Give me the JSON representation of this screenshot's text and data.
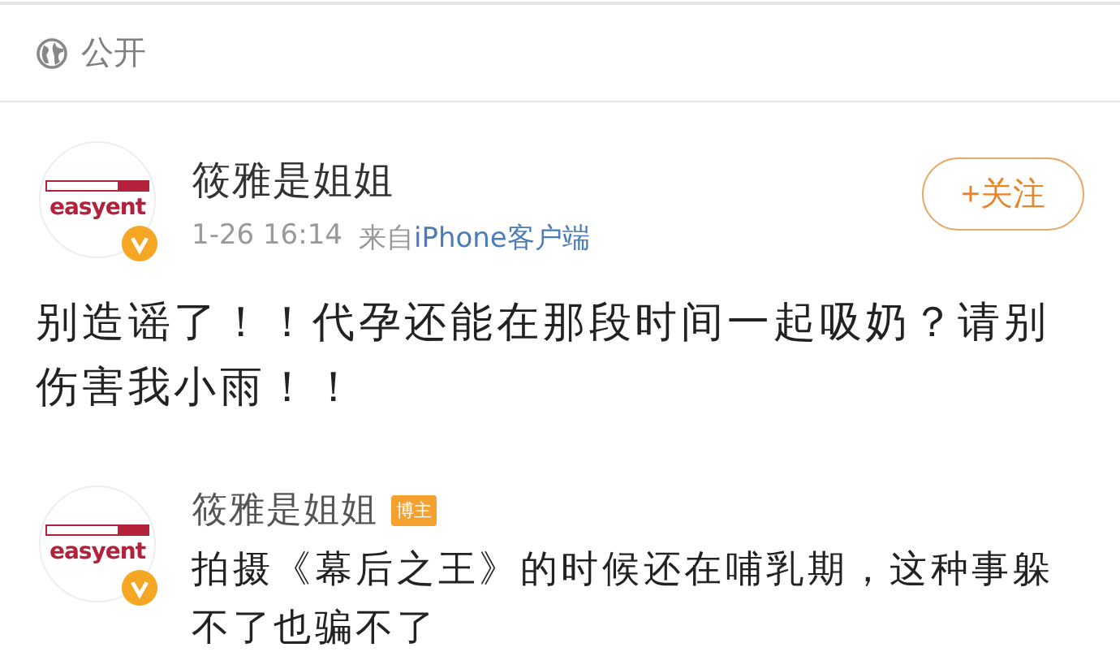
{
  "visibility": {
    "label": "公开"
  },
  "post": {
    "author": "筱雅是姐姐",
    "avatar_logo": "easyent",
    "verified": true,
    "time": "1-26 16:14",
    "source_prefix": "来自",
    "source": "iPhone客户端",
    "follow_button": "+关注",
    "text": "别造谣了！！代孕还能在那段时间一起吸奶？请别伤害我小雨！！"
  },
  "comments": [
    {
      "author": "筱雅是姐姐",
      "avatar_logo": "easyent",
      "verified": true,
      "badge": "博主",
      "text": "拍摄《幕后之王》的时候还在哺乳期，这种事躲不了也骗不了"
    }
  ]
}
